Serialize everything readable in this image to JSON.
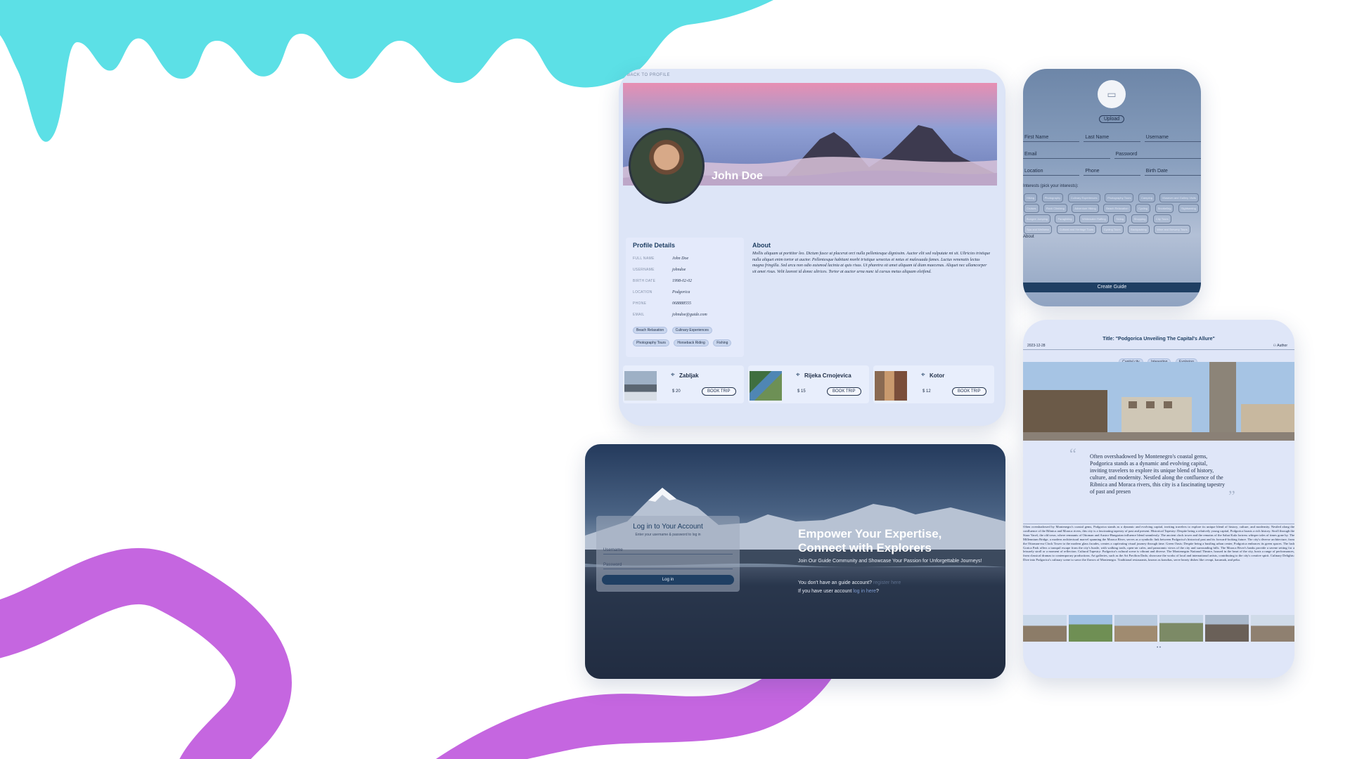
{
  "colors": {
    "cyan_blob": "#5ce0e6",
    "purple_wave": "#c566e0",
    "navy": "#1f3f63",
    "panel": "#dfe6f8"
  },
  "profile": {
    "back_link": "BACK TO PROFILE",
    "name": "John Doe",
    "details_title": "Profile Details",
    "details": [
      {
        "label": "FULL NAME",
        "value": "John Doe"
      },
      {
        "label": "USERNAME",
        "value": "johndoe"
      },
      {
        "label": "BIRTH DATE",
        "value": "1998-02-02"
      },
      {
        "label": "LOCATION",
        "value": "Podgorica"
      },
      {
        "label": "PHONE",
        "value": "068888555"
      },
      {
        "label": "EMAIL",
        "value": "johndoe@guide.com"
      }
    ],
    "interests": [
      "Beach Relaxation",
      "Culinary Experiences",
      "Photography Tours",
      "Horseback Riding",
      "Fishing"
    ],
    "about_title": "About",
    "about_text": "Mollis aliquam ut porttitor leo. Dictum fusce ut placerat orci nulla pellentesque dignissim. Auctor elit sed vulputate mi sit. Ultricies tristique nulla aliquet enim tortor at auctor. Pellentesque habitant morbi tristique senectus et netus et malesuada fames. Luctus venenatis lectus magna fringilla. Sed arcu non odio euismod lacinia at quis risus. Ut pharetra sit amet aliquam id diam maecenas. Aliquet nec ullamcorper sit amet risus. Velit laoreet id donec ultrices. Tortor at auctor urna nunc id cursus metus aliquam eleifend.",
    "trips": [
      {
        "place": "Zabljak",
        "price": "$ 20",
        "action": "BOOK TRIP"
      },
      {
        "place": "Rijeka Crnojevica",
        "price": "$ 15",
        "action": "BOOK TRIP"
      },
      {
        "place": "Kotor",
        "price": "$ 12",
        "action": "BOOK TRIP"
      }
    ]
  },
  "create_guide": {
    "upload": "Upload",
    "fields_row1": [
      "First Name",
      "Last Name",
      "Username"
    ],
    "fields_row2": [
      "Email",
      "Password"
    ],
    "fields_row3": [
      "Location",
      "Phone",
      "Birth Date"
    ],
    "interests_title": "Interests (pick your interests):",
    "interest_chips": [
      "Hiking",
      "Photography",
      "Culinary Experiences",
      "Photography Tours",
      "Camping",
      "Museum and Gallery Visits",
      "Cruises",
      "Rock Climbing",
      "Adventure Hiking",
      "Beach Relaxation",
      "Cycling",
      "Snorkeling",
      "Sightseeing",
      "Bungee Jumping",
      "Paragliding",
      "Whitewater Rafting",
      "Skiing",
      "Shopping",
      "City Tours",
      "Spa and Wellness",
      "Cultural and Heritage Tours",
      "Cycling Tours",
      "Backpacking",
      "Wine and Brewery Tours"
    ],
    "about_label": "About",
    "submit": "Create Guide"
  },
  "login": {
    "title": "Log in to Your Account",
    "subtitle": "Enter your username & password to log in",
    "username_placeholder": "Username",
    "password_placeholder": "Password",
    "button": "Log in",
    "headline_1": "Empower Your Expertise,",
    "headline_2": "Connect with Explorers",
    "tagline": "Join Our Guide Community and Showcase Your Passion for Unforgettable Journeys!",
    "register_prompt": "You don't have an guide account?",
    "register_link": "register here",
    "user_prompt": "If you have user account",
    "user_link": "log in here",
    "user_suffix": "?"
  },
  "article": {
    "date": "2023-12-28",
    "title": "Title: \"Podgorica Unveiling The Capital's Allure\"",
    "author": "Author",
    "tags": [
      "Capital city",
      "Interesting",
      "Exploring"
    ],
    "quote": "Often overshadowed by Montenegro's coastal gems, Podgorica stands as a dynamic and evolving capital, inviting travelers to explore its unique blend of history, culture, and modernity. Nestled along the confluence of the Ribnica and Moraca rivers, this city is a fascinating tapestry of past and presen",
    "body": "Often overshadowed by Montenegro's coastal gems, Podgorica stands as a dynamic and evolving capital, inviting travelers to explore its unique blend of history, culture, and modernity. Nestled along the confluence of the Ribnica and Moraca rivers, this city is a fascinating tapestry of past and present. Historical Tapestry: Despite being a relatively young capital, Podgorica boasts a rich history. Stroll through the Stara Varoš, the old town, where remnants of Ottoman and Austro-Hungarian influence blend seamlessly. The ancient clock tower and the remains of the Sahat Kula fortress whisper tales of times gone by. The Millennium Bridge, a modern architectural marvel spanning the Moraca River, serves as a symbolic link between Podgorica's historical past and its forward-looking future. The city's diverse architecture, from the Ottoman-era Clock Tower to the modern glass facades, creates a captivating visual journey through time. Green Oasis: Despite being a bustling urban center, Podgorica embraces its green spaces. The lush Gorica Park offers a tranquil escape from the city's hustle, with walking trails, open-air cafes, and panoramic views of the city and surrounding hills. The Moraca River's banks provide a serene setting for a leisurely stroll or a moment of reflection. Cultural Tapestry: Podgorica's cultural scene is vibrant and diverse. The Montenegrin National Theatre, housed in the heart of the city, hosts a range of performances, from classical dramas to contemporary productions. Art galleries, such as the Art Pavilion Dado, showcase the works of local and international artists, contributing to the city's creative spirit. Culinary Delights: Dive into Podgorica's culinary scene to savor the flavors of Montenegro. Traditional restaurants, known as konobas, serve hearty dishes like cevapi, kacamak, and peka."
  }
}
